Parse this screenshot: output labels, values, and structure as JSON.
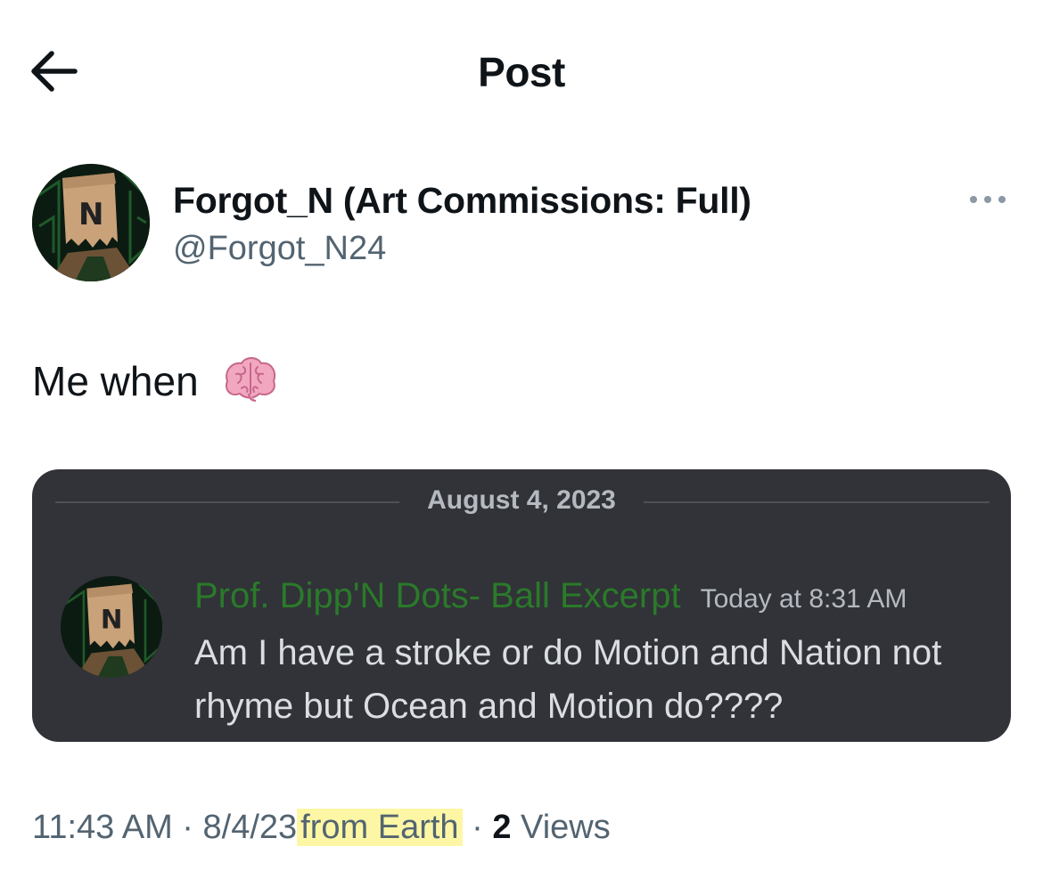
{
  "header": {
    "title": "Post",
    "back_icon": "arrow-left-icon"
  },
  "author": {
    "display_name": "Forgot_N (Art Commissions: Full)",
    "handle": "@Forgot_N24",
    "avatar_letter": "N",
    "more_icon": "more-horizontal-icon"
  },
  "post": {
    "text": "Me when",
    "emoji_icon": "brain-emoji-icon"
  },
  "embed": {
    "date": "August 4, 2023",
    "username": "Prof. Dipp'N Dots- Ball Excerpt",
    "timestamp": "Today at 8:31 AM",
    "message": "Am I have a stroke or do Motion and Nation not rhyme but Ocean and Motion do????",
    "avatar_letter": "N",
    "colors": {
      "background": "#313338",
      "username": "#2a7a2a",
      "text": "#dbdee1",
      "muted": "#b5bac1"
    }
  },
  "meta": {
    "time": "11:43 AM",
    "date": "8/4/23",
    "location": "from Earth",
    "separator": "·",
    "views_count": "2",
    "views_label": "Views",
    "highlight_color": "#fdf7a5"
  }
}
